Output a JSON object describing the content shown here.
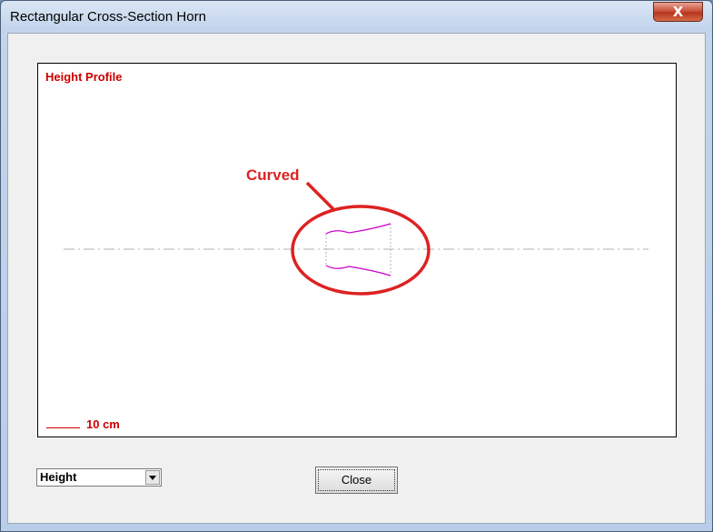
{
  "window": {
    "title": "Rectangular Cross-Section Horn",
    "close_glyph": "X"
  },
  "plot": {
    "title": "Height Profile",
    "scale_label": "10 cm",
    "annotation": "Curved",
    "colors": {
      "profile": "#cc00cc",
      "annotation": "#dd2222",
      "axis": "#b0b0b0",
      "text": "#cc0000"
    }
  },
  "controls": {
    "view_select_value": "Height",
    "close_button_label": "Close"
  }
}
